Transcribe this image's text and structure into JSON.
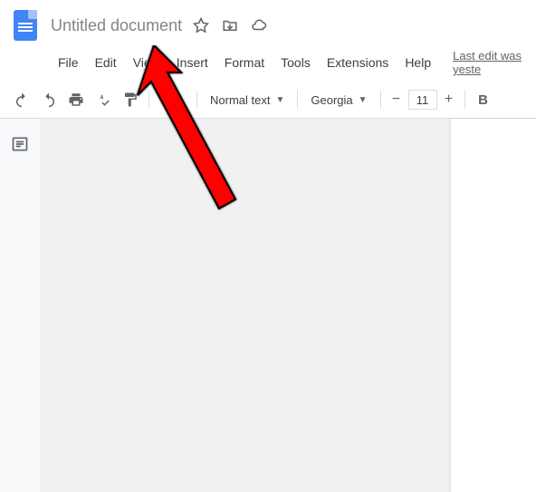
{
  "doc_title": "Untitled document",
  "menu": {
    "file": "File",
    "edit": "Edit",
    "view": "View",
    "insert": "Insert",
    "format": "Format",
    "tools": "Tools",
    "extensions": "Extensions",
    "help": "Help"
  },
  "last_edit": "Last edit was yeste",
  "toolbar": {
    "text_style": "Normal text",
    "font_family": "Georgia",
    "font_size": "11",
    "minus": "−",
    "plus": "+",
    "bold": "B"
  }
}
